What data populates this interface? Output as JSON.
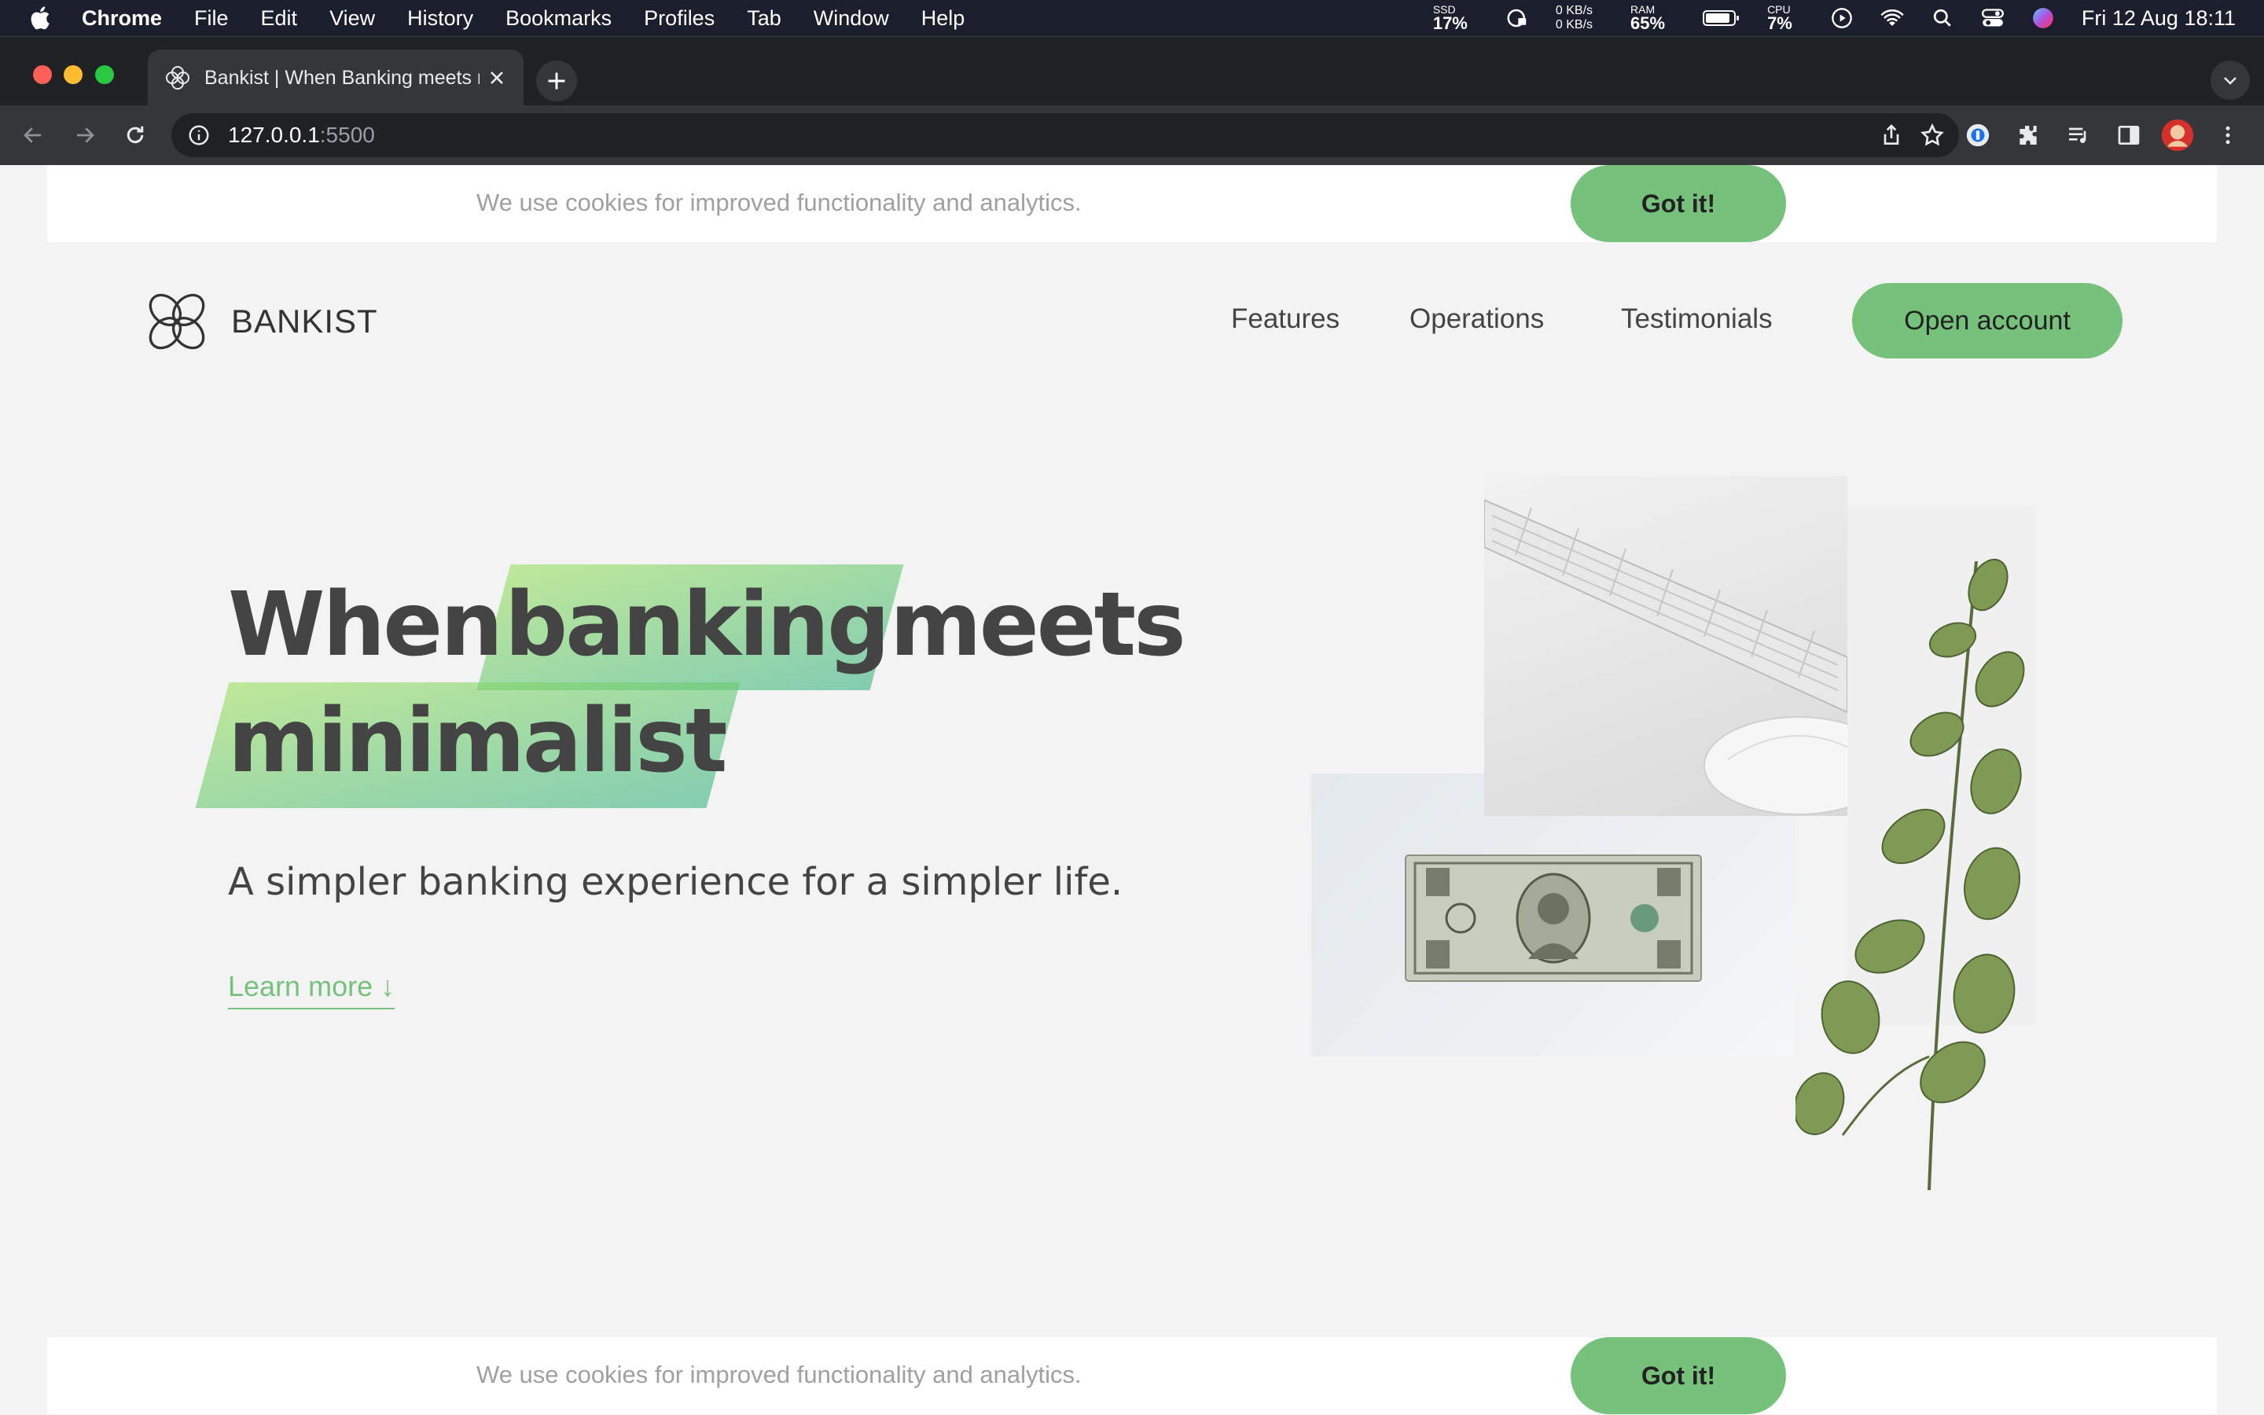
{
  "menubar": {
    "app": "Chrome",
    "menus": [
      "File",
      "Edit",
      "View",
      "History",
      "Bookmarks",
      "Profiles",
      "Tab",
      "Window",
      "Help"
    ],
    "ssd_label": "SSD",
    "ssd_value": "17%",
    "net_up": "0 KB/s",
    "net_down": "0 KB/s",
    "ram_label": "RAM",
    "ram_value": "65%",
    "cpu_label": "CPU",
    "cpu_value": "7%",
    "clock": "Fri 12 Aug  18:11"
  },
  "browser": {
    "tab_title": "Bankist | When Banking meets minimalist",
    "url_host": "127.0.0.1",
    "url_port": ":5500"
  },
  "page": {
    "cookie_message": "We use cookies for improved functionality and analytics.",
    "cookie_button": "Got it!",
    "logo_text": "BANKIST",
    "nav": [
      "Features",
      "Operations",
      "Testimonials"
    ],
    "open_account": "Open account",
    "headline_word1": "When",
    "headline_word2": "banking",
    "headline_word3": "meets",
    "headline_word4": "minimalist",
    "subtitle": "A simpler banking experience for a simpler life.",
    "learn_more": "Learn more ↓"
  },
  "colors": {
    "accent": "#76c27d",
    "page_bg": "#f3f3f3",
    "text": "#444444"
  }
}
